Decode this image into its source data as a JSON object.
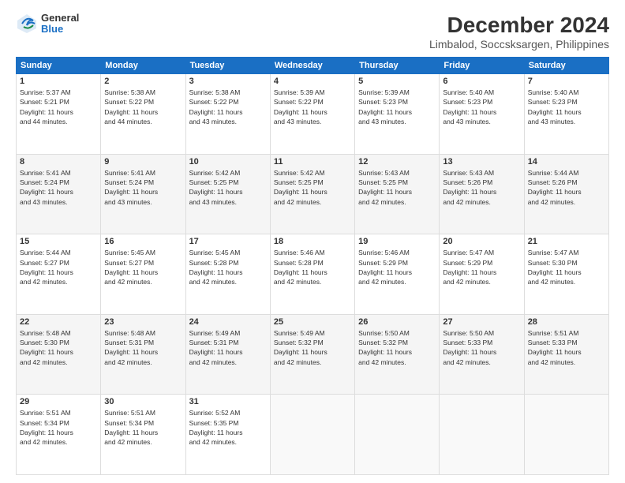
{
  "logo": {
    "general": "General",
    "blue": "Blue"
  },
  "title": "December 2024",
  "subtitle": "Limbalod, Soccsksargen, Philippines",
  "days_of_week": [
    "Sunday",
    "Monday",
    "Tuesday",
    "Wednesday",
    "Thursday",
    "Friday",
    "Saturday"
  ],
  "weeks": [
    [
      {
        "day": 1,
        "sunrise": "5:37 AM",
        "sunset": "5:21 PM",
        "daylight": "11 hours and 44 minutes."
      },
      {
        "day": 2,
        "sunrise": "5:38 AM",
        "sunset": "5:22 PM",
        "daylight": "11 hours and 44 minutes."
      },
      {
        "day": 3,
        "sunrise": "5:38 AM",
        "sunset": "5:22 PM",
        "daylight": "11 hours and 43 minutes."
      },
      {
        "day": 4,
        "sunrise": "5:39 AM",
        "sunset": "5:22 PM",
        "daylight": "11 hours and 43 minutes."
      },
      {
        "day": 5,
        "sunrise": "5:39 AM",
        "sunset": "5:23 PM",
        "daylight": "11 hours and 43 minutes."
      },
      {
        "day": 6,
        "sunrise": "5:40 AM",
        "sunset": "5:23 PM",
        "daylight": "11 hours and 43 minutes."
      },
      {
        "day": 7,
        "sunrise": "5:40 AM",
        "sunset": "5:23 PM",
        "daylight": "11 hours and 43 minutes."
      }
    ],
    [
      {
        "day": 8,
        "sunrise": "5:41 AM",
        "sunset": "5:24 PM",
        "daylight": "11 hours and 43 minutes."
      },
      {
        "day": 9,
        "sunrise": "5:41 AM",
        "sunset": "5:24 PM",
        "daylight": "11 hours and 43 minutes."
      },
      {
        "day": 10,
        "sunrise": "5:42 AM",
        "sunset": "5:25 PM",
        "daylight": "11 hours and 43 minutes."
      },
      {
        "day": 11,
        "sunrise": "5:42 AM",
        "sunset": "5:25 PM",
        "daylight": "11 hours and 42 minutes."
      },
      {
        "day": 12,
        "sunrise": "5:43 AM",
        "sunset": "5:25 PM",
        "daylight": "11 hours and 42 minutes."
      },
      {
        "day": 13,
        "sunrise": "5:43 AM",
        "sunset": "5:26 PM",
        "daylight": "11 hours and 42 minutes."
      },
      {
        "day": 14,
        "sunrise": "5:44 AM",
        "sunset": "5:26 PM",
        "daylight": "11 hours and 42 minutes."
      }
    ],
    [
      {
        "day": 15,
        "sunrise": "5:44 AM",
        "sunset": "5:27 PM",
        "daylight": "11 hours and 42 minutes."
      },
      {
        "day": 16,
        "sunrise": "5:45 AM",
        "sunset": "5:27 PM",
        "daylight": "11 hours and 42 minutes."
      },
      {
        "day": 17,
        "sunrise": "5:45 AM",
        "sunset": "5:28 PM",
        "daylight": "11 hours and 42 minutes."
      },
      {
        "day": 18,
        "sunrise": "5:46 AM",
        "sunset": "5:28 PM",
        "daylight": "11 hours and 42 minutes."
      },
      {
        "day": 19,
        "sunrise": "5:46 AM",
        "sunset": "5:29 PM",
        "daylight": "11 hours and 42 minutes."
      },
      {
        "day": 20,
        "sunrise": "5:47 AM",
        "sunset": "5:29 PM",
        "daylight": "11 hours and 42 minutes."
      },
      {
        "day": 21,
        "sunrise": "5:47 AM",
        "sunset": "5:30 PM",
        "daylight": "11 hours and 42 minutes."
      }
    ],
    [
      {
        "day": 22,
        "sunrise": "5:48 AM",
        "sunset": "5:30 PM",
        "daylight": "11 hours and 42 minutes."
      },
      {
        "day": 23,
        "sunrise": "5:48 AM",
        "sunset": "5:31 PM",
        "daylight": "11 hours and 42 minutes."
      },
      {
        "day": 24,
        "sunrise": "5:49 AM",
        "sunset": "5:31 PM",
        "daylight": "11 hours and 42 minutes."
      },
      {
        "day": 25,
        "sunrise": "5:49 AM",
        "sunset": "5:32 PM",
        "daylight": "11 hours and 42 minutes."
      },
      {
        "day": 26,
        "sunrise": "5:50 AM",
        "sunset": "5:32 PM",
        "daylight": "11 hours and 42 minutes."
      },
      {
        "day": 27,
        "sunrise": "5:50 AM",
        "sunset": "5:33 PM",
        "daylight": "11 hours and 42 minutes."
      },
      {
        "day": 28,
        "sunrise": "5:51 AM",
        "sunset": "5:33 PM",
        "daylight": "11 hours and 42 minutes."
      }
    ],
    [
      {
        "day": 29,
        "sunrise": "5:51 AM",
        "sunset": "5:34 PM",
        "daylight": "11 hours and 42 minutes."
      },
      {
        "day": 30,
        "sunrise": "5:51 AM",
        "sunset": "5:34 PM",
        "daylight": "11 hours and 42 minutes."
      },
      {
        "day": 31,
        "sunrise": "5:52 AM",
        "sunset": "5:35 PM",
        "daylight": "11 hours and 42 minutes."
      },
      null,
      null,
      null,
      null
    ]
  ],
  "labels": {
    "sunrise": "Sunrise:",
    "sunset": "Sunset:",
    "daylight": "Daylight:"
  }
}
